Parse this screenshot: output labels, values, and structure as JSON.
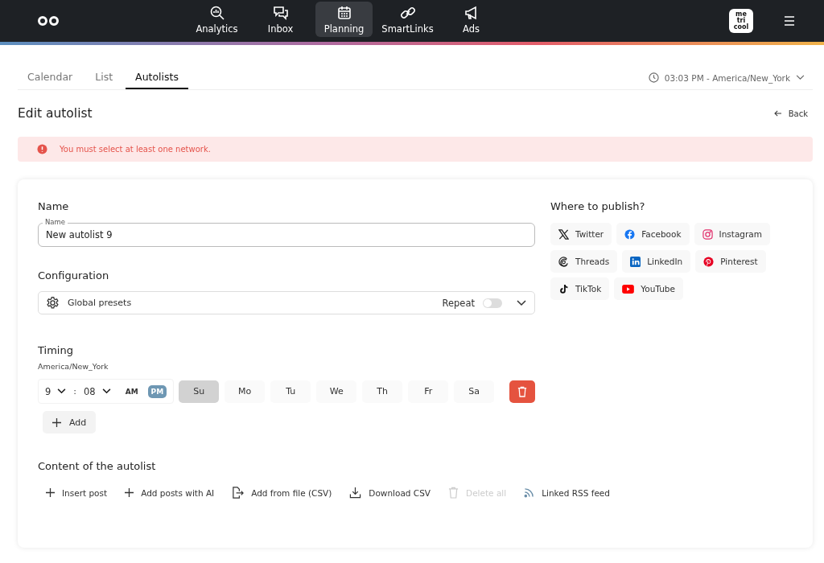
{
  "nav": {
    "items": [
      {
        "label": "Analytics",
        "kind": "analytics",
        "selected": false
      },
      {
        "label": "Inbox",
        "kind": "inbox",
        "selected": false
      },
      {
        "label": "Planning",
        "kind": "calendar",
        "selected": true
      },
      {
        "label": "SmartLinks",
        "kind": "links",
        "selected": false
      },
      {
        "label": "Ads",
        "kind": "megaphone",
        "selected": false
      }
    ],
    "brand_badge": [
      "me",
      "tri",
      "cool"
    ]
  },
  "tabs": [
    {
      "label": "Calendar",
      "selected": false
    },
    {
      "label": "List",
      "selected": false
    },
    {
      "label": "Autolists",
      "selected": true
    }
  ],
  "timezone_selector": "03:03 PM - America/New_York",
  "page_title": "Edit autolist",
  "back_link": "Back",
  "alert": "You must select at least one network.",
  "name_section": {
    "heading": "Name",
    "field_label": "Name",
    "value": "New autolist 9"
  },
  "configuration": {
    "heading": "Configuration",
    "preset": "Global presets",
    "repeat_label": "Repeat",
    "repeat_on": false
  },
  "timing": {
    "heading": "Timing",
    "timezone": "America/New_York",
    "hour": "9",
    "separator": ":",
    "minute": "08",
    "periods": [
      {
        "label": "AM",
        "selected": false
      },
      {
        "label": "PM",
        "selected": true
      }
    ],
    "days": [
      {
        "label": "Su",
        "selected": true
      },
      {
        "label": "Mo",
        "selected": false
      },
      {
        "label": "Tu",
        "selected": false
      },
      {
        "label": "We",
        "selected": false
      },
      {
        "label": "Th",
        "selected": false
      },
      {
        "label": "Fr",
        "selected": false
      },
      {
        "label": "Sa",
        "selected": false
      }
    ],
    "add_button": "Add"
  },
  "content": {
    "heading": "Content of the autolist",
    "actions": [
      {
        "label": "Insert post",
        "kind": "plus",
        "disabled": false
      },
      {
        "label": "Add posts with AI",
        "kind": "plus",
        "disabled": false
      },
      {
        "label": "Add from file (CSV)",
        "kind": "file",
        "disabled": false
      },
      {
        "label": "Download CSV",
        "kind": "download",
        "disabled": false
      },
      {
        "label": "Delete all",
        "kind": "trash",
        "disabled": true
      },
      {
        "label": "Linked RSS feed",
        "kind": "rss",
        "disabled": false
      }
    ]
  },
  "publish": {
    "heading": "Where to publish?",
    "networks": [
      {
        "label": "Twitter",
        "kind": "x",
        "selected": false
      },
      {
        "label": "Facebook",
        "kind": "facebook",
        "selected": false
      },
      {
        "label": "Instagram",
        "kind": "instagram",
        "selected": false
      },
      {
        "label": "Threads",
        "kind": "threads",
        "selected": false
      },
      {
        "label": "LinkedIn",
        "kind": "linkedin",
        "selected": false
      },
      {
        "label": "Pinterest",
        "kind": "pinterest",
        "selected": false
      },
      {
        "label": "TikTok",
        "kind": "tiktok",
        "selected": false
      },
      {
        "label": "YouTube",
        "kind": "youtube",
        "selected": false
      }
    ]
  }
}
